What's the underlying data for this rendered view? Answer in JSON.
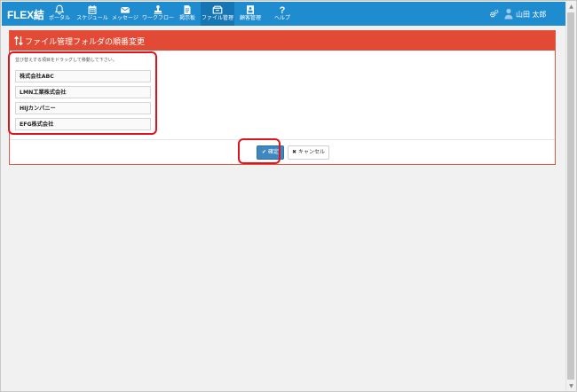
{
  "app": {
    "logo": "FLEX結"
  },
  "nav": {
    "items": [
      {
        "label": "ポータル",
        "icon": "bell-icon"
      },
      {
        "label": "スケジュール",
        "icon": "calendar-icon"
      },
      {
        "label": "メッセージ",
        "icon": "envelope-icon"
      },
      {
        "label": "ワークフロー",
        "icon": "stamp-icon"
      },
      {
        "label": "掲示板",
        "icon": "document-icon"
      },
      {
        "label": "ファイル管理",
        "icon": "folder-icon"
      },
      {
        "label": "顧客管理",
        "icon": "id-card-icon"
      },
      {
        "label": "ヘルプ",
        "icon": "help-icon"
      }
    ],
    "active_index": 5
  },
  "user": {
    "name": "山田 太郎"
  },
  "panel": {
    "title": "ファイル管理フォルダの順番変更",
    "hint": "並び替えする項目をドラッグして移動して下さい。",
    "items": [
      "株式会社ABC",
      "LMN工業株式会社",
      "HIJカンパニー",
      "EFG株式会社"
    ],
    "ok_label": "確定",
    "cancel_label": "キャンセル"
  },
  "colors": {
    "nav_bg": "#1f8ccf",
    "header_bg": "#e24a35",
    "ok_bg": "#3f87bf",
    "highlight": "#e0141b"
  }
}
